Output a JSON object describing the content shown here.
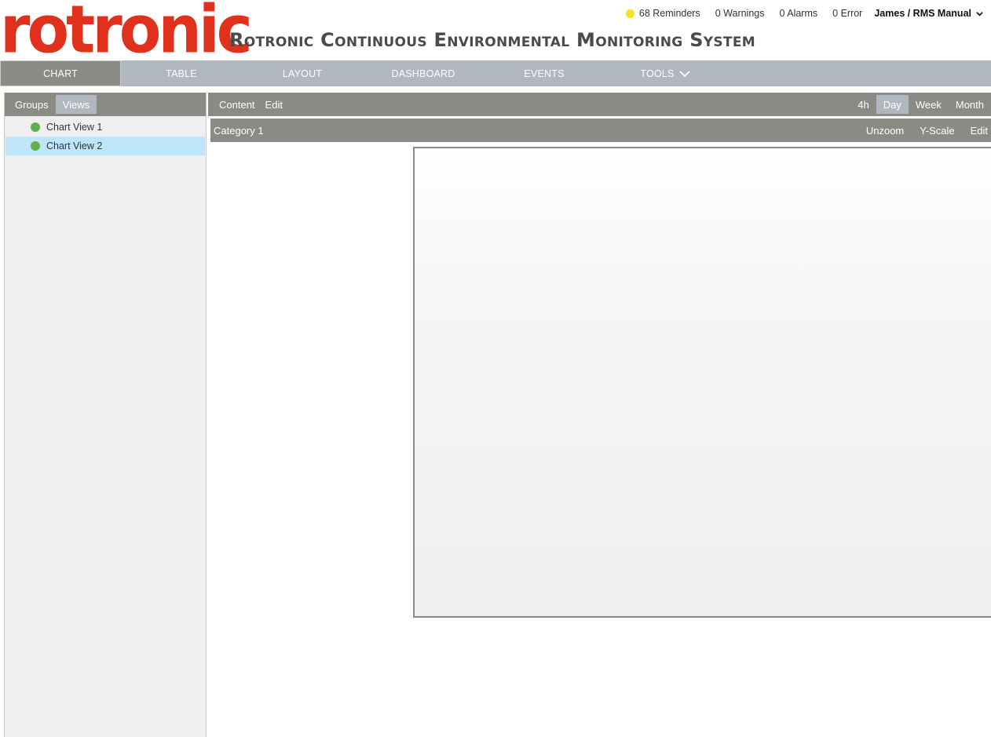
{
  "brand": {
    "logo_text": "rotronic",
    "app_title": "Rotronic Continuous Environmental Monitoring System",
    "logo_color": "#e0311d",
    "title_color": "#4a4a4a"
  },
  "status": {
    "reminders": "68 Reminders",
    "warnings": "0 Warnings",
    "alarms": "0 Alarms",
    "errors": "0 Error",
    "user": "James / RMS Manual",
    "reminder_color": "#f5e31b"
  },
  "nav": {
    "bg_color": "#b1b7bf",
    "active_color": "#8b8b86",
    "items": [
      {
        "label": "Chart",
        "active": true
      },
      {
        "label": "Table"
      },
      {
        "label": "Layout"
      },
      {
        "label": "Dashboard"
      },
      {
        "label": "Events"
      },
      {
        "label": "Tools",
        "has_dropdown": true
      }
    ]
  },
  "sidebar": {
    "tabs": [
      {
        "label": "Groups"
      },
      {
        "label": "Views",
        "active": true
      }
    ],
    "items": [
      {
        "label": "Chart View 1",
        "status_color": "#5fb04a"
      },
      {
        "label": "Chart View 2",
        "status_color": "#5fb04a",
        "selected": true
      }
    ],
    "selected_color": "#bde6fb"
  },
  "toolbar": {
    "bar_color": "#8b8b86",
    "active_btn_color": "#b1b7bf",
    "left": [
      {
        "label": "Content"
      },
      {
        "label": "Edit"
      }
    ],
    "ranges": [
      {
        "label": "4h"
      },
      {
        "label": "Day",
        "active": true
      },
      {
        "label": "Week"
      },
      {
        "label": "Month"
      }
    ]
  },
  "category": {
    "title": "Category 1",
    "actions": [
      {
        "label": "Unzoom"
      },
      {
        "label": "Y-Scale"
      },
      {
        "label": "Edit"
      }
    ]
  }
}
